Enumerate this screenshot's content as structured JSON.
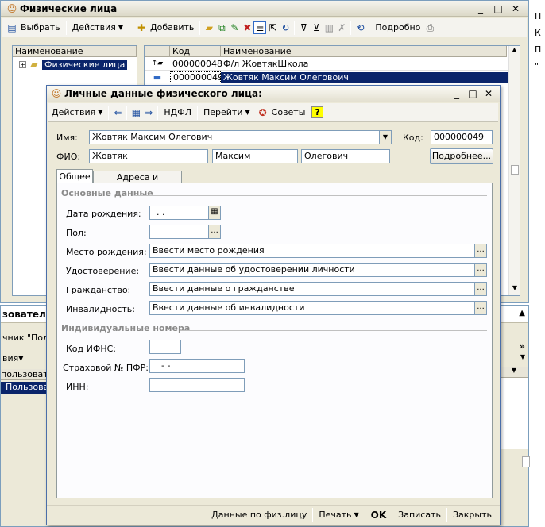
{
  "main_window": {
    "title": "Физические лица",
    "toolbar": {
      "select": "Выбрать",
      "actions": "Действия",
      "add": "Добавить",
      "details": "Подробно"
    },
    "tree_header": "Наименование",
    "tree_root": "Физические лица",
    "list_headers": {
      "code": "Код",
      "name": "Наименование"
    },
    "rows": [
      {
        "code": "000000048",
        "name": "Ф/л ЖовтякШкола"
      },
      {
        "code": "000000049",
        "name": "Жовтяк Максим Олеговоич"
      }
    ]
  },
  "bg_window": {
    "title": "зователи",
    "text1": "чник \"Поль",
    "actions": "вия",
    "col": "пользоват",
    "row": "Пользова"
  },
  "right_partial": {
    "lines": [
      "П",
      "К",
      "П",
      "\""
    ]
  },
  "dialog": {
    "title": "Личные данные физического лица:",
    "toolbar": {
      "actions": "Действия",
      "ndfl": "НДФЛ",
      "goto": "Перейти",
      "tips": "Советы",
      "help": "?"
    },
    "name_label": "Имя:",
    "name_value": "Жовтяк Максим Олегович",
    "code_label": "Код:",
    "code_value": "000000049",
    "fio_label": "ФИО:",
    "fio_last": "Жовтяк",
    "fio_first": "Максим",
    "fio_middle": "Олегович",
    "details_button": "Подробнее...",
    "tabs": [
      "Общее",
      "Адреса и телефоны"
    ],
    "section_main": "Основные данные",
    "birth_label": "Дата рождения:",
    "birth_value": " .  .",
    "sex_label": "Пол:",
    "birthplace_label": "Место рождения:",
    "birthplace_value": "Ввести место рождения",
    "id_label": "Удостоверение:",
    "id_value": "Ввести данные об удостоверении личности",
    "citizen_label": "Гражданство:",
    "citizen_value": "Ввести данные о гражданстве",
    "disab_label": "Инвалидность:",
    "disab_value": "Ввести данные об инвалидности",
    "section_ids": "Индивидуальные номера",
    "ifns_label": "Код ИФНС:",
    "pfr_label": "Страховой № ПФР:",
    "pfr_value": "-   -",
    "inn_label": "ИНН:",
    "bottom": {
      "data": "Данные по физ.лицу",
      "print": "Печать",
      "ok": "OK",
      "save": "Записать",
      "close": "Закрыть"
    }
  }
}
